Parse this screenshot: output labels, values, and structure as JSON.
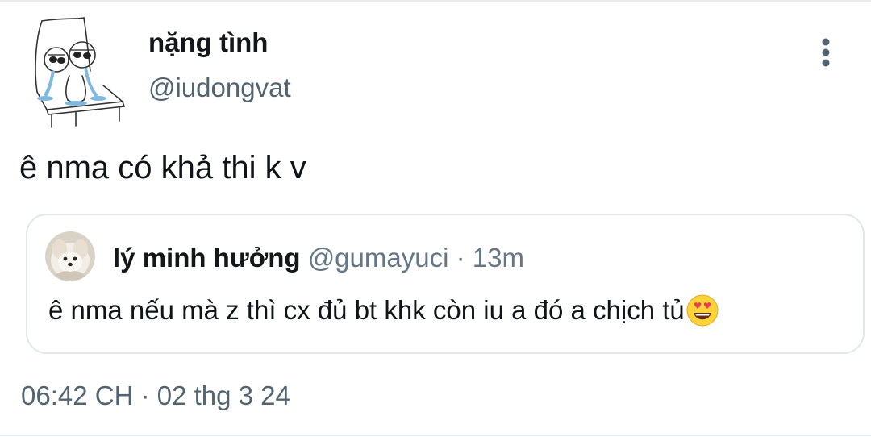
{
  "tweet": {
    "author": {
      "display_name": "nặng tình",
      "handle": "@iudongvat",
      "avatar_icon": "crying-figure-on-chair-sketch"
    },
    "text": "ê nma có khả thi k v",
    "timestamp": "06:42 CH · 02 thg 3 24",
    "more_icon": "more-vertical-icon"
  },
  "quoted_tweet": {
    "author": {
      "display_name": "lý minh hưởng",
      "handle": "@gumayuci",
      "avatar_icon": "fluffy-dog-photo"
    },
    "time_sep": "·",
    "time": "13m",
    "text": "ê nma nếu mà z thì cx đủ bt khk còn iu a đó a chịch tủ",
    "emoji": "smiling-face-with-heart-eyes"
  },
  "colors": {
    "text_primary": "#0f1419",
    "text_secondary": "#536471",
    "border": "#e1e8ed",
    "background": "#ffffff"
  }
}
